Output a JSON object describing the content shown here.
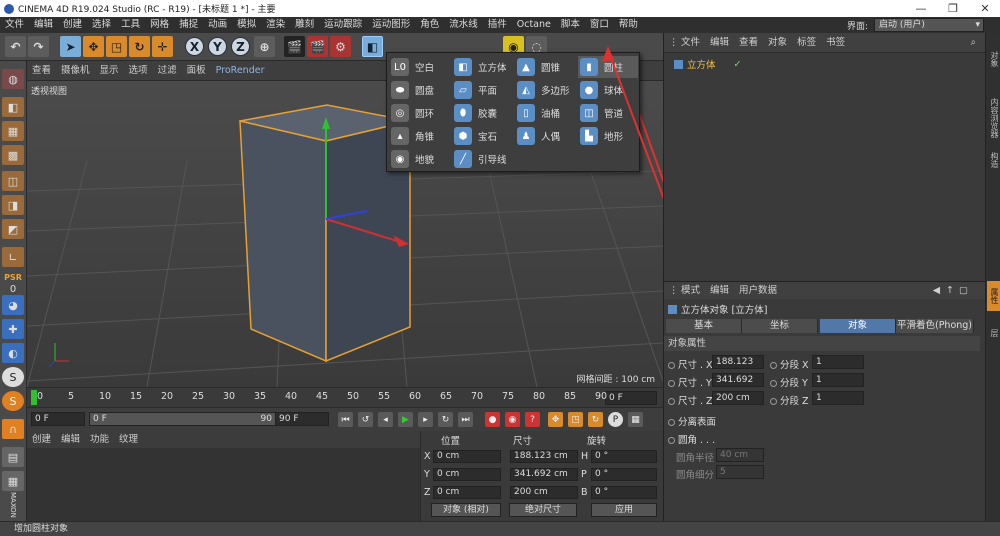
{
  "window": {
    "title": "CINEMA 4D R19.024 Studio (RC - R19) - [未标题 1 *] - 主要",
    "minimize": "—",
    "maximize": "❐",
    "close": "✕"
  },
  "menubar": {
    "items": [
      "文件",
      "编辑",
      "创建",
      "选择",
      "工具",
      "网格",
      "捕捉",
      "动画",
      "模拟",
      "渲染",
      "雕刻",
      "运动跟踪",
      "运动图形",
      "角色",
      "流水线",
      "插件",
      "Octane",
      "脚本",
      "窗口",
      "帮助"
    ],
    "layout_label": "界面:",
    "layout_value": "启动 (用户)"
  },
  "toolbar": {
    "undo": "↶",
    "redo": "↷",
    "axes": [
      "X",
      "Y",
      "Z"
    ]
  },
  "viewport_menu": {
    "items": [
      "查看",
      "摄像机",
      "显示",
      "选项",
      "过滤",
      "面板"
    ],
    "prorender": "ProRender"
  },
  "viewport": {
    "label": "透视视图",
    "grid_spacing": "网格间距 : 100 cm"
  },
  "timeline": {
    "ticks": [
      "0",
      "5",
      "10",
      "15",
      "20",
      "25",
      "30",
      "35",
      "40",
      "45",
      "50",
      "55",
      "60",
      "65",
      "70",
      "75",
      "80",
      "85",
      "90"
    ],
    "current_frame_field": "0 F"
  },
  "playbar": {
    "start": "0 F",
    "range_start": "0 F",
    "range_end": "90 F",
    "end": "90 F"
  },
  "material_panel": {
    "menu": [
      "创建",
      "编辑",
      "功能",
      "纹理"
    ]
  },
  "coords": {
    "headers": [
      "位置",
      "尺寸",
      "旋转"
    ],
    "rows": [
      {
        "axis": "X",
        "pos": "0 cm",
        "size": "188.123 cm",
        "rot_label": "H",
        "rot": "0 °"
      },
      {
        "axis": "Y",
        "pos": "0 cm",
        "size": "341.692 cm",
        "rot_label": "P",
        "rot": "0 °"
      },
      {
        "axis": "Z",
        "pos": "0 cm",
        "size": "200 cm",
        "rot_label": "B",
        "rot": "0 °"
      }
    ],
    "mode": "对象 (相对)",
    "size_mode": "绝对尺寸",
    "apply": "应用"
  },
  "object_manager": {
    "menu": [
      "文件",
      "编辑",
      "查看",
      "对象",
      "标签",
      "书签"
    ],
    "object_name": "立方体"
  },
  "attributes": {
    "menu": [
      "模式",
      "编辑",
      "用户数据"
    ],
    "title": "立方体对象 [立方体]",
    "tabs": [
      "基本",
      "坐标",
      "对象",
      "平滑着色(Phong)"
    ],
    "section": "对象属性",
    "rows": [
      {
        "label": "尺寸 . X",
        "value": "188.123 cm",
        "seg_label": "分段 X",
        "seg": "1"
      },
      {
        "label": "尺寸 . Y",
        "value": "341.692 cm",
        "seg_label": "分段 Y",
        "seg": "1"
      },
      {
        "label": "尺寸 . Z",
        "value": "200 cm",
        "seg_label": "分段 Z",
        "seg": "1"
      }
    ],
    "separate": "分离表面",
    "fillet": "圆角 . . .",
    "fillet_radius_label": "圆角半径",
    "fillet_radius": "40 cm",
    "fillet_sub_label": "圆角细分",
    "fillet_sub": "5"
  },
  "right_tabs": [
    "对象",
    "内容浏览器",
    "构造",
    "层",
    "属性"
  ],
  "popup": {
    "items": [
      {
        "label": "空白",
        "icon": "L0",
        "col": 0,
        "row": 0
      },
      {
        "label": "立方体",
        "icon": "cube-icon",
        "col": 1,
        "row": 0
      },
      {
        "label": "圆锥",
        "icon": "cone-icon",
        "col": 2,
        "row": 0
      },
      {
        "label": "圆柱",
        "icon": "cylinder-icon",
        "col": 3,
        "row": 0
      },
      {
        "label": "圆盘",
        "icon": "disc-icon",
        "col": 0,
        "row": 1
      },
      {
        "label": "平面",
        "icon": "plane-icon",
        "col": 1,
        "row": 1
      },
      {
        "label": "多边形",
        "icon": "polygon-icon",
        "col": 2,
        "row": 1
      },
      {
        "label": "球体",
        "icon": "sphere-icon",
        "col": 3,
        "row": 1
      },
      {
        "label": "圆环",
        "icon": "torus-icon",
        "col": 0,
        "row": 2
      },
      {
        "label": "胶囊",
        "icon": "capsule-icon",
        "col": 1,
        "row": 2
      },
      {
        "label": "油桶",
        "icon": "oiltank-icon",
        "col": 2,
        "row": 2
      },
      {
        "label": "管道",
        "icon": "tube-icon",
        "col": 3,
        "row": 2
      },
      {
        "label": "角锥",
        "icon": "pyramid-icon",
        "col": 0,
        "row": 3
      },
      {
        "label": "宝石",
        "icon": "gem-icon",
        "col": 1,
        "row": 3
      },
      {
        "label": "人偶",
        "icon": "figure-icon",
        "col": 2,
        "row": 3
      },
      {
        "label": "地形",
        "icon": "landscape-icon",
        "col": 3,
        "row": 3
      },
      {
        "label": "地貌",
        "icon": "relief-icon",
        "col": 0,
        "row": 4
      },
      {
        "label": "引导线",
        "icon": "guide-icon",
        "col": 1,
        "row": 4
      }
    ],
    "highlighted": "圆柱"
  },
  "status": "增加圆柱对象",
  "colors": {
    "accent": "#5277a9",
    "highlight_object": "#f0c040",
    "arrow": "#e03030"
  }
}
